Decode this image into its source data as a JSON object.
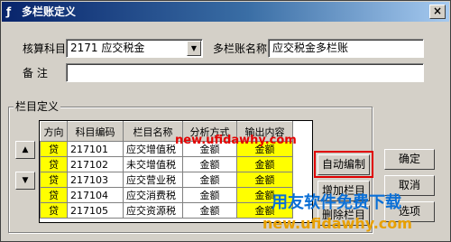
{
  "window": {
    "title": "多栏账定义",
    "close_glyph": "×"
  },
  "form": {
    "account_label": "核算科目",
    "account_value": "2171  应交税金",
    "name_label": "多栏账名称",
    "name_value": "应交税金多栏账",
    "remark_label": "备  注",
    "remark_value": ""
  },
  "group": {
    "title": "栏目定义"
  },
  "grid": {
    "headers": [
      "方向",
      "科目编码",
      "栏目名称",
      "分析方式",
      "输出内容"
    ],
    "rows": [
      [
        "贷",
        "217101",
        "应交增值税",
        "金额",
        "金额"
      ],
      [
        "贷",
        "217102",
        "未交增值税",
        "金额",
        "金额"
      ],
      [
        "贷",
        "217103",
        "应交营业税",
        "金额",
        "金额"
      ],
      [
        "贷",
        "217104",
        "应交消费税",
        "金额",
        "金额"
      ],
      [
        "贷",
        "217105",
        "应交资源税",
        "金额",
        "金额"
      ]
    ]
  },
  "buttons": {
    "up_glyph": "▲",
    "down_glyph": "▼",
    "auto": "自动编制",
    "add": "增加栏目",
    "delete": "删除栏目",
    "ok": "确定",
    "cancel": "取消",
    "options": "选项"
  },
  "watermarks": {
    "url_red": "new.ufidawhy.com",
    "brand": "用友软件免费下载",
    "url_orange": "new.ufidawhy.com"
  },
  "colors": {
    "title_bar": "#08246b",
    "highlight_border": "#e00000",
    "yellow_cell": "#ffff00"
  }
}
